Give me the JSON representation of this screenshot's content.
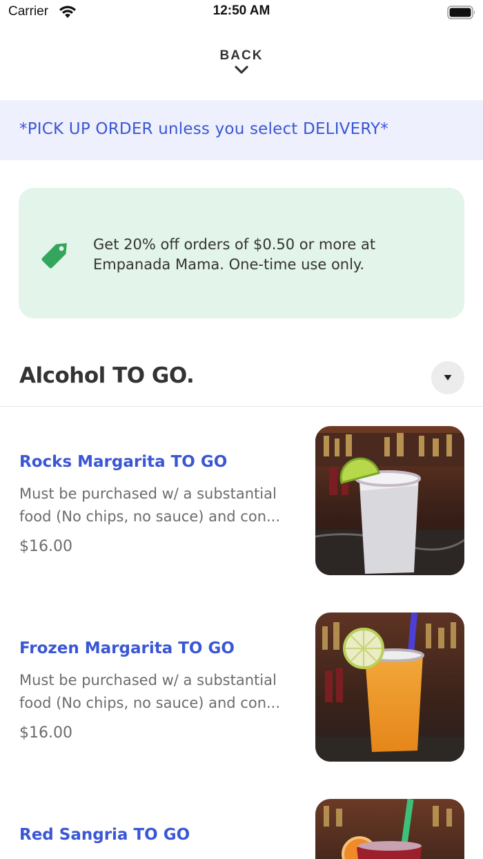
{
  "status_bar": {
    "carrier": "Carrier",
    "time": "12:50 AM"
  },
  "header": {
    "back_label": "BACK"
  },
  "notice": {
    "text": "*PICK UP ORDER unless you select DELIVERY*"
  },
  "promo": {
    "line1": "Get 20% off orders of $0.50 or more at",
    "line2": "Empanada Mama. One-time use only.",
    "icon": "tag-icon",
    "color": "#34a55c"
  },
  "section": {
    "title": "Alcohol TO GO."
  },
  "items": [
    {
      "name": "Rocks Margarita TO GO",
      "desc_line1": "Must be purchased w/ a substantial",
      "desc_line2": "food (No chips, no sauce) and con...",
      "price": "$16.00"
    },
    {
      "name": "Frozen Margarita TO GO",
      "desc_line1": "Must be purchased w/ a substantial",
      "desc_line2": "food (No chips, no sauce) and con...",
      "price": "$16.00"
    },
    {
      "name": "Red Sangria TO GO"
    }
  ],
  "colors": {
    "accent": "#3a56d4",
    "notice_bg": "#eef0fd",
    "promo_bg": "#e3f4ea"
  }
}
